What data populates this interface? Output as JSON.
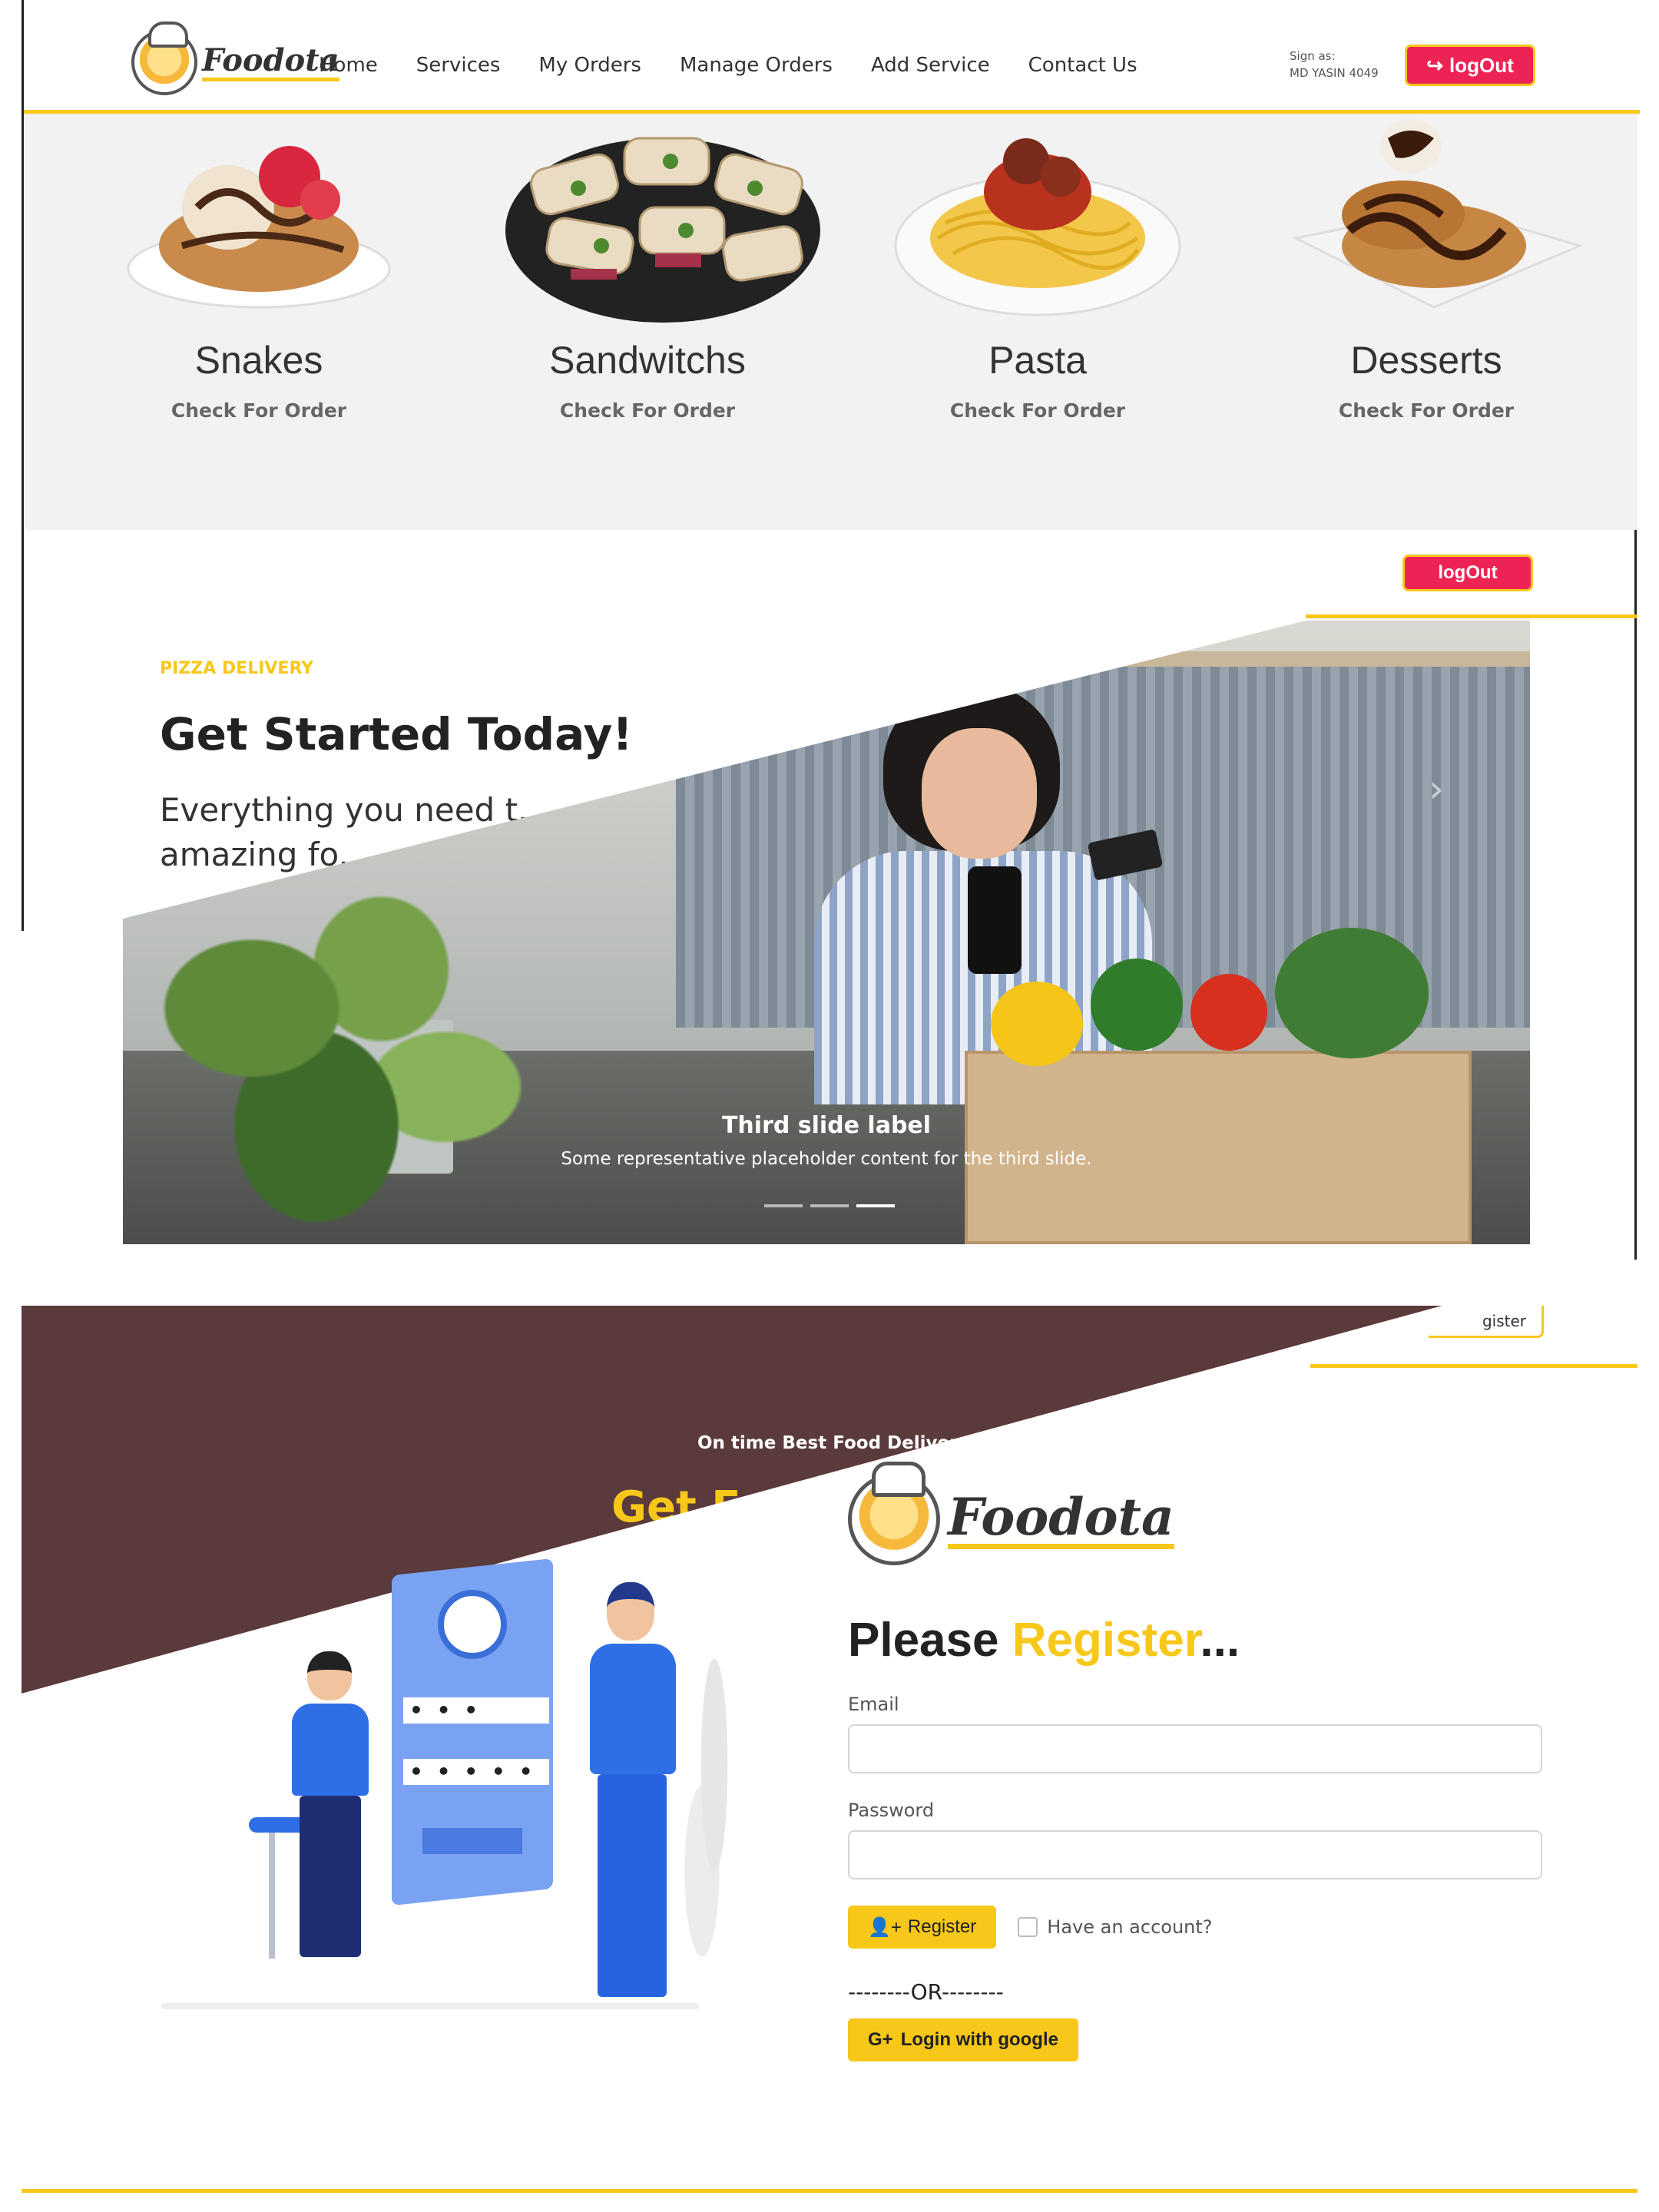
{
  "brand": {
    "name": "Foodota",
    "accent": "#f7c71a",
    "danger": "#ee2355",
    "brown": "#5a3a3a"
  },
  "nav": {
    "items": [
      "Home",
      "Services",
      "My Orders",
      "Manage Orders",
      "Add Service",
      "Contact Us"
    ],
    "signed_label": "Sign as:",
    "signed_user": "MD YASIN 4049",
    "logout_label": "logOut",
    "logout_icon": "sign-out-icon"
  },
  "categories": [
    {
      "title": "Snakes",
      "link": "Check For Order"
    },
    {
      "title": "Sandwitchs",
      "link": "Check For Order"
    },
    {
      "title": "Pasta",
      "link": "Check For Order"
    },
    {
      "title": "Desserts",
      "link": "Check For Order"
    }
  ],
  "hero": {
    "logout_label": "logOut",
    "kicker": "PIZZA DELIVERY",
    "heading": "Get Started Today!",
    "paragraph": "Everything you need t... amazing fo...",
    "slide_title": "Third slide label",
    "slide_text": "Some representative placeholder content for the third slide."
  },
  "section3": {
    "brown_kicker": "On time Best Food Delivery",
    "brown_heading": "Get F",
    "register_tab": "gister"
  },
  "register": {
    "brand": "Foodota",
    "title_prefix": "Please ",
    "title_accent": "Register",
    "title_suffix": "...",
    "email_label": "Email",
    "email_value": "",
    "password_label": "Password",
    "password_value": "",
    "register_button": "Register",
    "register_icon": "user-plus-icon",
    "have_account": "Have an account?",
    "or_divider": "--------OR--------",
    "google_button": "Login with google",
    "google_icon": "google-icon",
    "illustration_field1": "• • •",
    "illustration_field2": "• • • • •"
  }
}
